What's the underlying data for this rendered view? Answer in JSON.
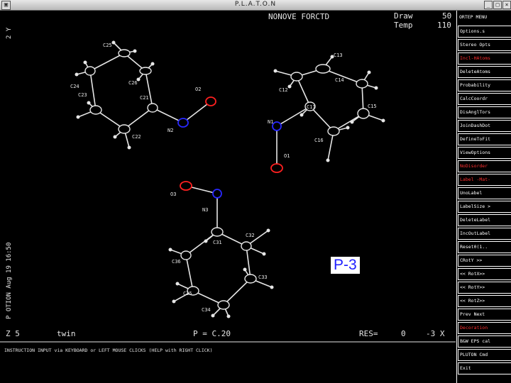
{
  "window": {
    "title": "P.L.A.T.O.N",
    "icon_glyph": "▣",
    "minimize_glyph": "_",
    "maximize_glyph": "□",
    "close_glyph": "×"
  },
  "hud": {
    "header": "NONOVE FORCTD",
    "draw_label": "Draw",
    "draw_value": "50",
    "temp_label": "Temp",
    "temp_value": "110",
    "side_upper": "2 Y",
    "side_lower": "P OTION Aug 19 16:50",
    "bottom_left": "Z 5",
    "bottom_tw": "twin",
    "bottom_p": "P = C.20",
    "bottom_res_label": "RES=",
    "bottom_res_value": "0",
    "bottom_right": "-3 X",
    "instruction": "INSTRUCTION INPUT via KEYBOARD or LEFT MOUSE CLICKS (HELP with RIGHT CLICK)"
  },
  "atoms": {
    "C25": "C25",
    "C26": "C26",
    "C24": "C24",
    "C23": "C23",
    "C21": "C21",
    "C22": "C22",
    "N2": "N2",
    "O2": "O2",
    "C13": "C13",
    "C14": "C14",
    "C12": "C12",
    "C11": "C11",
    "C15": "C15",
    "C16": "C16",
    "N1": "N1",
    "O1": "O1",
    "O3": "O3",
    "N3": "N3",
    "C31": "C31",
    "C32": "C32",
    "C36": "C36",
    "C33": "C33",
    "C35": "C35",
    "C34": "C34"
  },
  "overlay_label": "P-3",
  "menu": [
    {
      "label": "ORTEP MENU",
      "color": "white",
      "boxed": false
    },
    {
      "label": "Options.s",
      "color": "white",
      "boxed": true
    },
    {
      "label": "Stereo Opts",
      "color": "white",
      "boxed": true
    },
    {
      "label": "Incl-HAtoms",
      "color": "red",
      "boxed": true
    },
    {
      "label": "DeleteAtoms",
      "color": "white",
      "boxed": true
    },
    {
      "label": "Probability",
      "color": "white",
      "boxed": true
    },
    {
      "label": "CalcCoordr",
      "color": "white",
      "boxed": true
    },
    {
      "label": "DisAnglTors",
      "color": "white",
      "boxed": true
    },
    {
      "label": "JoinDashDot",
      "color": "white",
      "boxed": true
    },
    {
      "label": "DefineToFit",
      "color": "white",
      "boxed": true
    },
    {
      "label": "ViewOptions",
      "color": "white",
      "boxed": true
    },
    {
      "label": "NoDisorder",
      "color": "red",
      "boxed": true
    },
    {
      "label": "Label -Mat-",
      "color": "red",
      "boxed": true
    },
    {
      "label": "UnoLabel",
      "color": "white",
      "boxed": true
    },
    {
      "label": "LabelSize >",
      "color": "white",
      "boxed": true
    },
    {
      "label": "DeleteLabel",
      "color": "white",
      "boxed": true
    },
    {
      "label": "IncOutLabel",
      "color": "white",
      "boxed": true
    },
    {
      "label": "Reset0(1..",
      "color": "white",
      "boxed": true
    },
    {
      "label": "CRotY >>",
      "color": "white",
      "boxed": true
    },
    {
      "label": "<< RotX>>",
      "color": "white",
      "boxed": true
    },
    {
      "label": "<< RotY>>",
      "color": "white",
      "boxed": true
    },
    {
      "label": "<< RotZ>>",
      "color": "white",
      "boxed": true
    },
    {
      "label": "Prev  Next",
      "color": "white",
      "boxed": true
    },
    {
      "label": "Decoration",
      "color": "red",
      "boxed": true
    },
    {
      "label": "B&W EPS cal",
      "color": "white",
      "boxed": true
    },
    {
      "label": "PLUTON  Cmd",
      "color": "white",
      "boxed": true
    },
    {
      "label": "Exit",
      "color": "white",
      "boxed": true
    }
  ]
}
